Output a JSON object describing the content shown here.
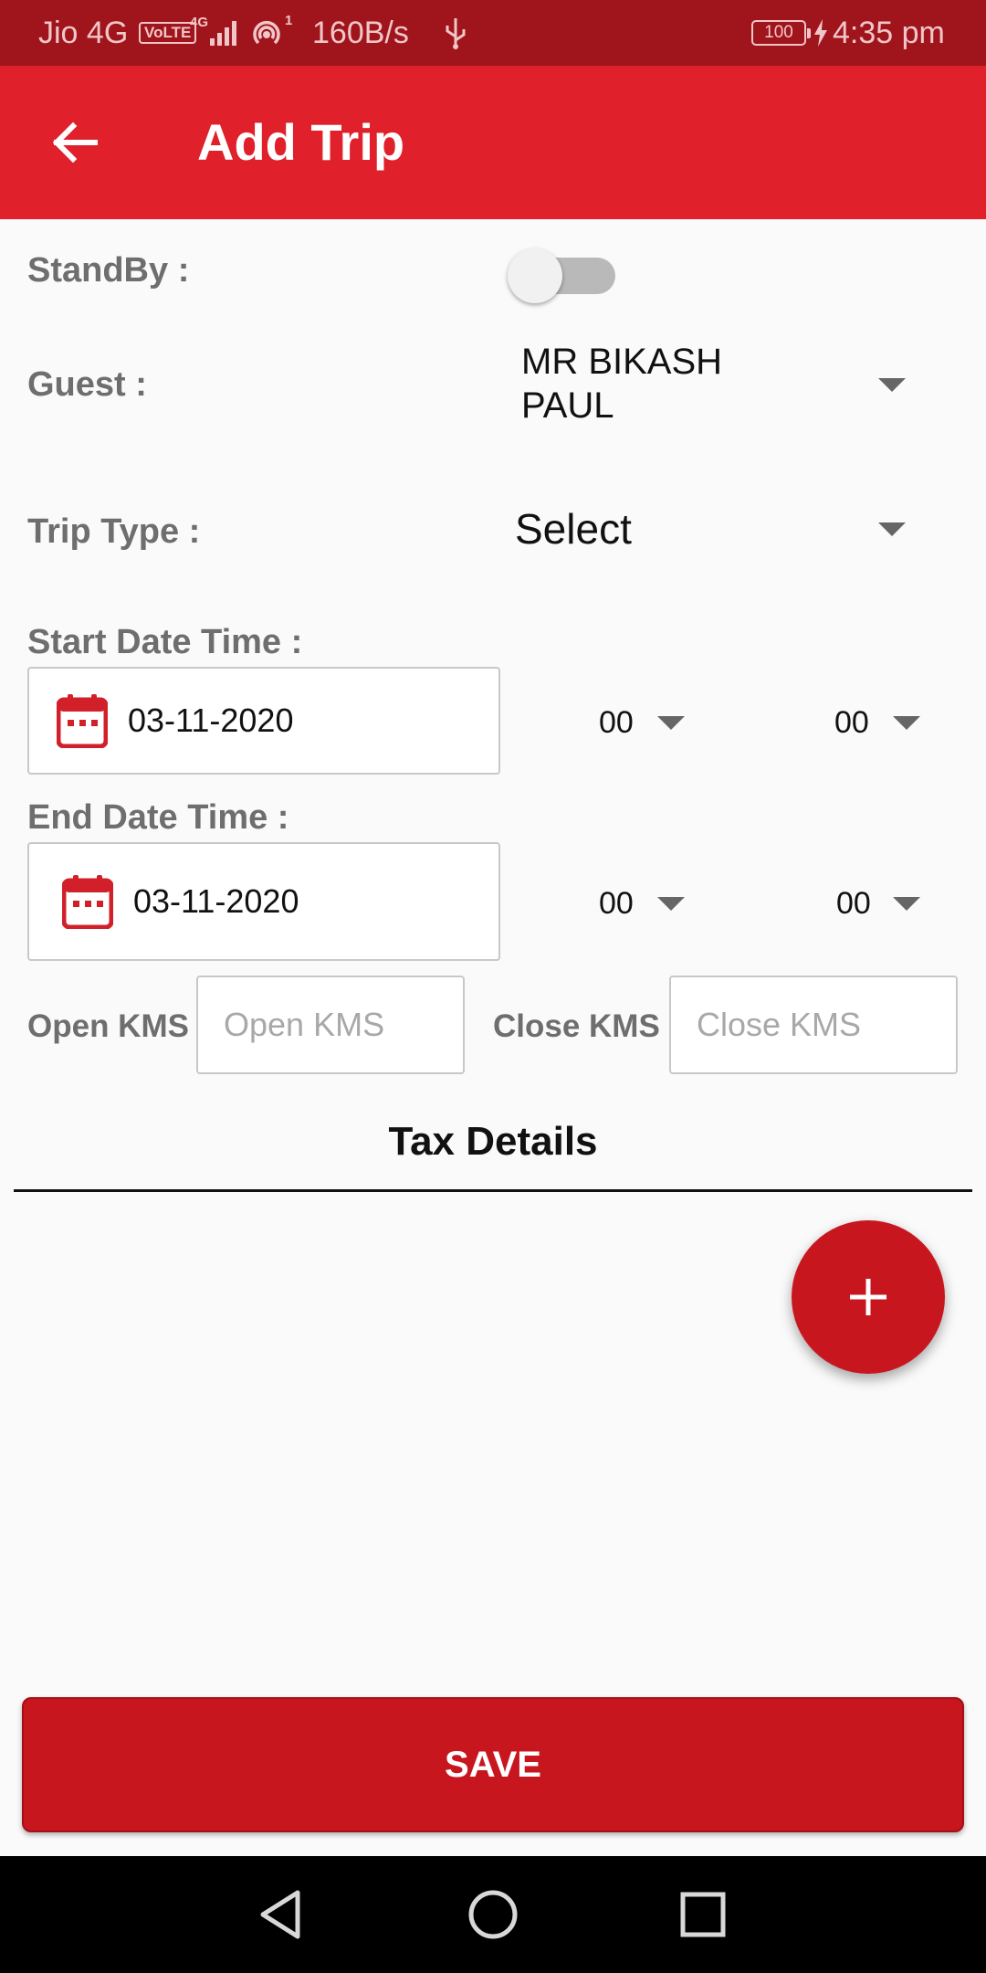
{
  "status_bar": {
    "carrier": "Jio 4G",
    "volte": "VoLTE",
    "network_type": "4G",
    "wifi_badge": "1",
    "data_rate": "160B/s",
    "battery": "100",
    "time": "4:35 pm"
  },
  "app_bar": {
    "title": "Add Trip",
    "back_icon": "arrow-left-icon"
  },
  "form": {
    "standby": {
      "label": "StandBy :",
      "on": false
    },
    "guest": {
      "label": "Guest :",
      "value": "MR BIKASH PAUL"
    },
    "trip_type": {
      "label": "Trip Type :",
      "value": "Select"
    },
    "start": {
      "label": "Start Date Time :",
      "date": "03-11-2020",
      "hour": "00",
      "minute": "00"
    },
    "end": {
      "label": "End Date Time :",
      "date": "03-11-2020",
      "hour": "00",
      "minute": "00"
    },
    "open_kms": {
      "label": "Open KMS",
      "placeholder": "Open KMS",
      "value": ""
    },
    "close_kms": {
      "label": "Close KMS",
      "placeholder": "Close KMS",
      "value": ""
    }
  },
  "tax": {
    "title": "Tax Details",
    "add_icon": "plus-icon"
  },
  "save_label": "SAVE",
  "colors": {
    "primary": "#e0202a",
    "status_bar": "#a0141c",
    "accent": "#c8161f"
  },
  "nav_icons": [
    "back-triangle-icon",
    "home-circle-icon",
    "recents-square-icon"
  ]
}
